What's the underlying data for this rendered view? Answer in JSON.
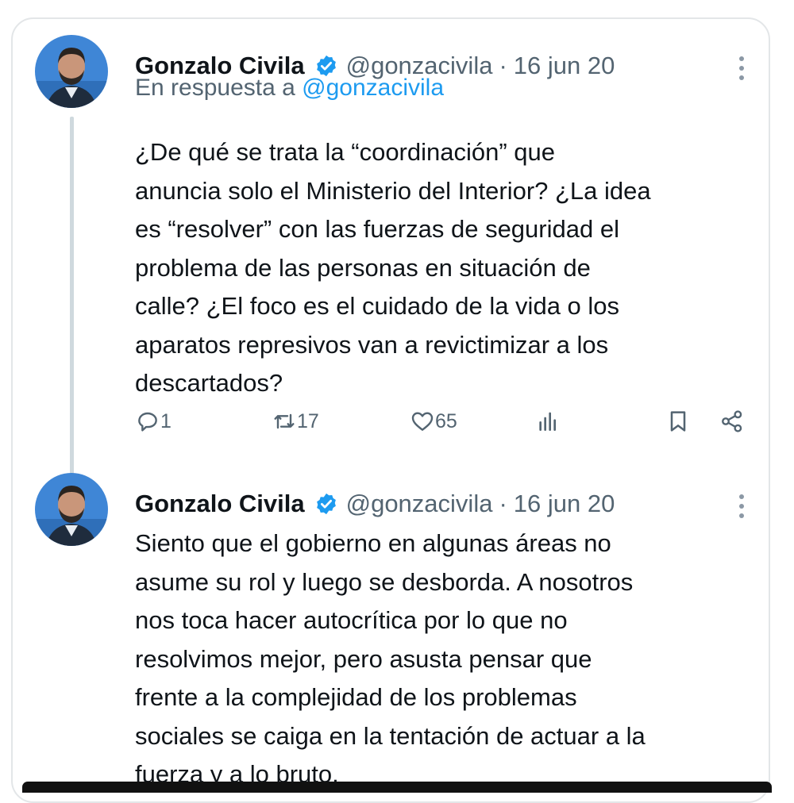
{
  "tweets": [
    {
      "author_name": "Gonzalo Civila",
      "handle": "@gonzacivila",
      "separator": "·",
      "date": "16 jun 20",
      "reply_prefix": "En respuesta a",
      "reply_to": "@gonzacivila",
      "text": "¿De qué se trata la “coordinación” que\nanuncia solo el Ministerio del Interior? ¿La idea\nes “resolver” con las fuerzas de seguridad el\nproblema de las personas en situación de\ncalle? ¿El foco es el cuidado de la vida o los\naparatos represivos van a revictimizar a los\ndescartados?",
      "metrics": {
        "replies": "1",
        "reposts": "17",
        "likes": "65"
      }
    },
    {
      "author_name": "Gonzalo Civila",
      "handle": "@gonzacivila",
      "separator": "·",
      "date": "16 jun 20",
      "text": "Siento que el gobierno en algunas áreas no\nasume su rol y luego se desborda. A nosotros\nnos toca hacer autocrítica por lo que no\nresolvimos mejor, pero asusta pensar que\nfrente a la complejidad de los problemas\nsociales se caiga en la tentación de actuar a la\nfuerza y a lo bruto."
    }
  ],
  "icons": {
    "verified": "verified-badge-icon",
    "more": "more-options-icon",
    "reply": "reply-icon",
    "repost": "repost-icon",
    "like": "heart-icon",
    "views": "views-icon",
    "bookmark": "bookmark-icon",
    "share": "share-icon"
  },
  "colors": {
    "accent": "#1d9bf0",
    "text": "#0f1419",
    "secondary": "#536471",
    "thread_line": "#cfd9de"
  }
}
